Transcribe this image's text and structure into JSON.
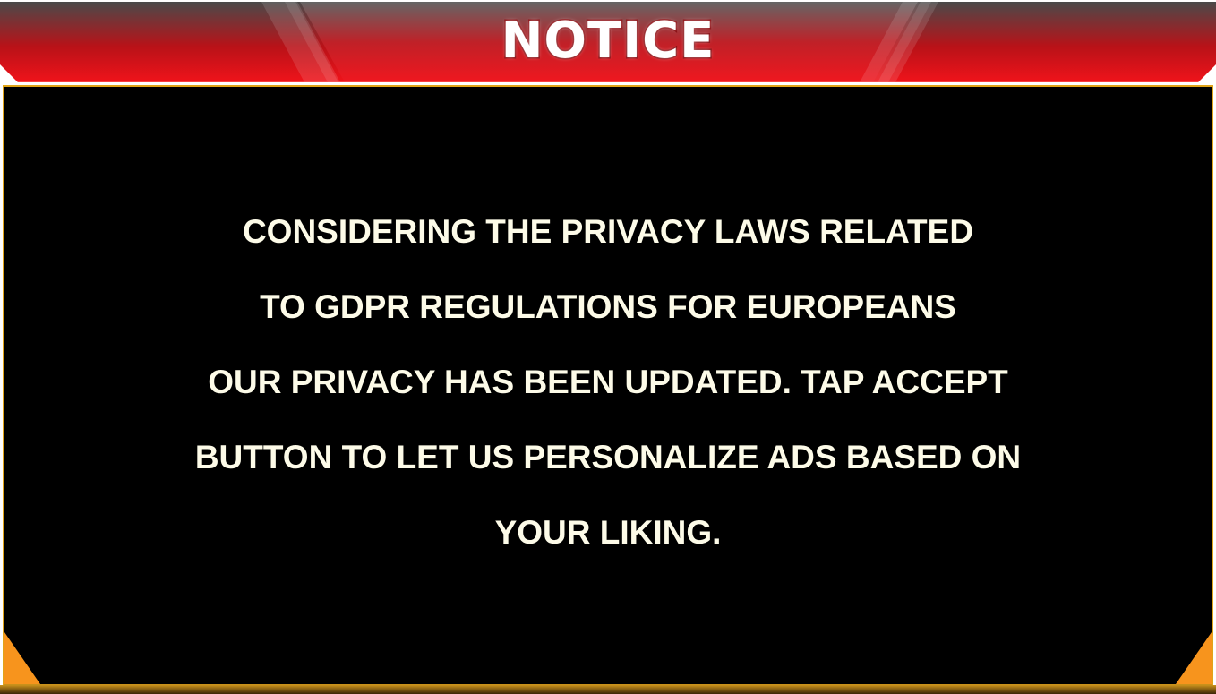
{
  "dialog": {
    "title": "NOTICE",
    "message_lines": [
      "CONSIDERING THE PRIVACY LAWS RELATED",
      "TO GDPR REGULATIONS FOR EUROPEANS",
      " OUR PRIVACY HAS BEEN UPDATED. TAP ACCEPT",
      "BUTTON TO LET US PERSONALIZE ADS BASED ON",
      "YOUR LIKING."
    ]
  },
  "colors": {
    "header_red": "#e01016",
    "header_dark": "#4a4a4a",
    "panel_background": "#000000",
    "panel_border": "#e0a419",
    "corner_accent": "#f7941d",
    "message_text": "#fdfbe8"
  }
}
